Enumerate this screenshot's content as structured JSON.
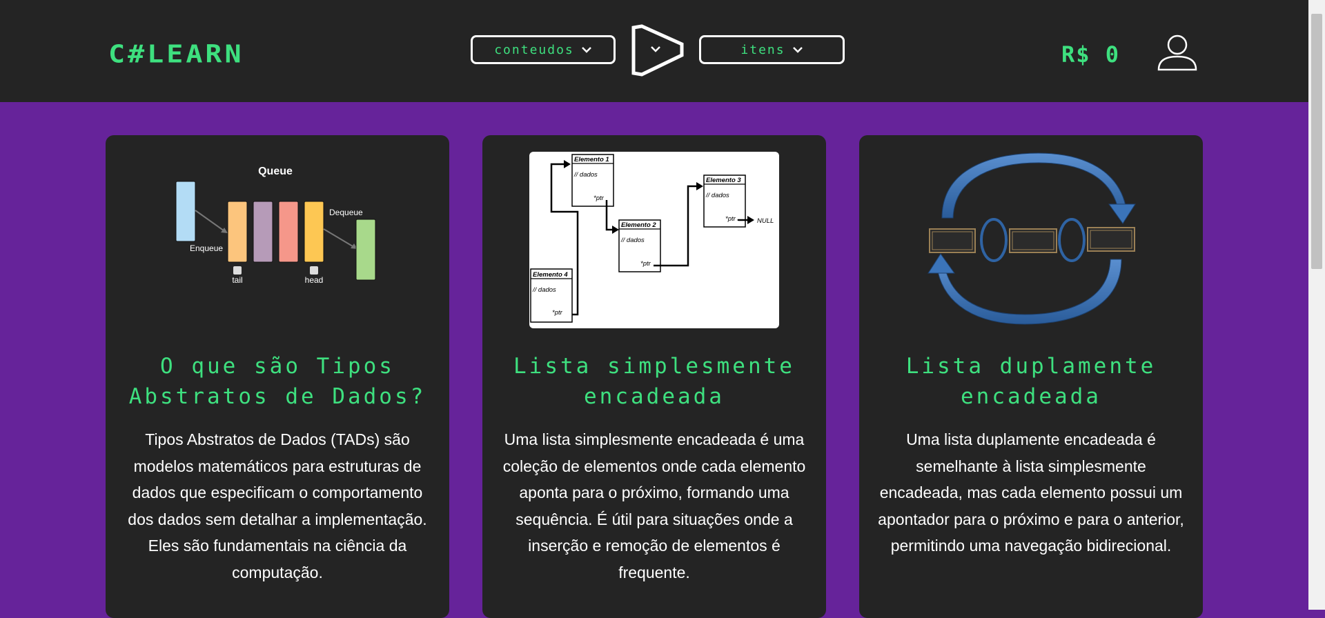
{
  "header": {
    "brand": "C#LEARN",
    "nav": [
      {
        "label": "conteudos"
      },
      {
        "label": "itens"
      }
    ],
    "balance": "R$ 0"
  },
  "cards": [
    {
      "title": "O que são Tipos Abstratos de Dados?",
      "text": "Tipos Abstratos de Dados (TADs) são modelos matemáticos para estruturas de dados que especificam o comportamento dos dados sem detalhar a implementação. Eles são fundamentais na ciência da computação.",
      "image": {
        "title": "Queue",
        "labels": {
          "enqueue": "Enqueue",
          "dequeue": "Dequeue",
          "tail": "tail",
          "head": "head"
        }
      }
    },
    {
      "title": "Lista simplesmente encadeada",
      "text": "Uma lista simplesmente encadeada é uma coleção de elementos onde cada elemento aponta para o próximo, formando uma sequência. É útil para situações onde a inserção e remoção de elementos é frequente.",
      "image": {
        "nodes": [
          {
            "name": "Elemento 1",
            "data": "// dados",
            "ptr": "*ptr"
          },
          {
            "name": "Elemento 2",
            "data": "// dados",
            "ptr": "*ptr"
          },
          {
            "name": "Elemento 3",
            "data": "// dados",
            "ptr": "*ptr"
          },
          {
            "name": "Elemento 4",
            "data": "// dados",
            "ptr": "*ptr"
          }
        ],
        "null_label": "NULL"
      }
    },
    {
      "title": "Lista duplamente encadeada",
      "text": "Uma lista duplamente encadeada é semelhante à lista simplesmente encadeada, mas cada elemento possui um apontador para o próximo e para o anterior, permitindo uma navegação bidirecional.",
      "image": {}
    }
  ],
  "colors": {
    "accent": "#3ee07f",
    "header_bg": "#242424",
    "page_bg": "#66239a",
    "card_bg": "#242424"
  },
  "icons": [
    "chevron-down-icon",
    "play-logo-icon",
    "user-icon"
  ]
}
